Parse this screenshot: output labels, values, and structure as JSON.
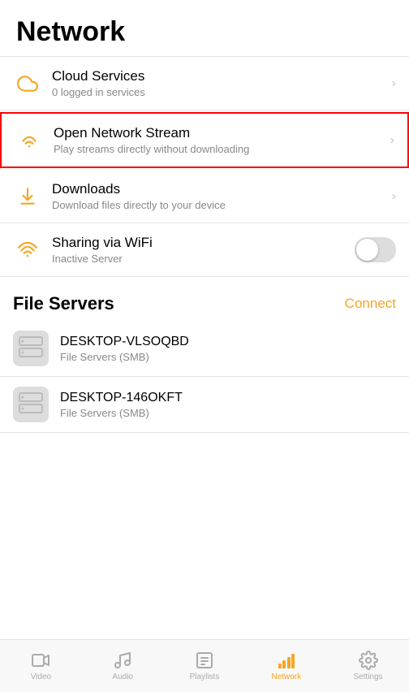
{
  "header": {
    "title": "Network"
  },
  "list_items": [
    {
      "id": "cloud-services",
      "title": "Cloud Services",
      "subtitle": "0 logged in services",
      "icon": "cloud",
      "has_chevron": true,
      "has_toggle": false,
      "highlighted": false
    },
    {
      "id": "open-network-stream",
      "title": "Open Network Stream",
      "subtitle": "Play streams directly without downloading",
      "icon": "wifi-stream",
      "has_chevron": true,
      "has_toggle": false,
      "highlighted": true
    },
    {
      "id": "downloads",
      "title": "Downloads",
      "subtitle": "Download files directly to your device",
      "icon": "download",
      "has_chevron": true,
      "has_toggle": false,
      "highlighted": false
    },
    {
      "id": "sharing-wifi",
      "title": "Sharing via WiFi",
      "subtitle": "Inactive Server",
      "icon": "wifi",
      "has_chevron": false,
      "has_toggle": true,
      "highlighted": false
    }
  ],
  "file_servers": {
    "section_title": "File Servers",
    "connect_label": "Connect",
    "servers": [
      {
        "name": "DESKTOP-VLSOQBD",
        "type": "File Servers (SMB)"
      },
      {
        "name": "DESKTOP-146OKFT",
        "type": "File Servers (SMB)"
      }
    ]
  },
  "tab_bar": {
    "tabs": [
      {
        "id": "video",
        "label": "Video",
        "icon": "video",
        "active": false
      },
      {
        "id": "audio",
        "label": "Audio",
        "icon": "audio",
        "active": false
      },
      {
        "id": "playlists",
        "label": "Playlists",
        "icon": "playlists",
        "active": false
      },
      {
        "id": "network",
        "label": "Network",
        "icon": "network",
        "active": true
      },
      {
        "id": "settings",
        "label": "Settings",
        "icon": "settings",
        "active": false
      }
    ]
  },
  "colors": {
    "accent": "#f5a623",
    "highlight_border": "red",
    "icon_color": "#f5a623",
    "text_primary": "#000",
    "text_secondary": "#888"
  }
}
